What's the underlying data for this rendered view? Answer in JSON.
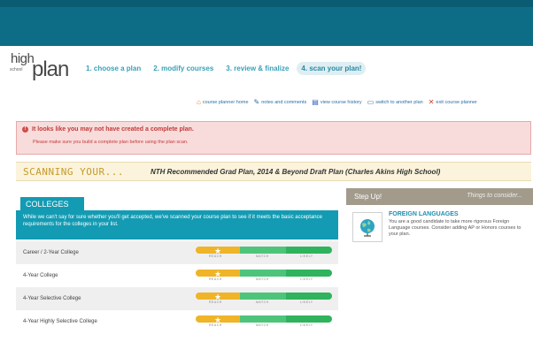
{
  "logo": {
    "high": "high",
    "school": "school",
    "plan": "plan"
  },
  "steps": [
    "1. choose a plan",
    "2. modify courses",
    "3. review & finalize",
    "4. scan your plan!"
  ],
  "tools": [
    {
      "icon": "home-icon",
      "glyph": "⌂",
      "label": "course planner home"
    },
    {
      "icon": "comments-icon",
      "glyph": "✎",
      "label": "notes and comments"
    },
    {
      "icon": "history-icon",
      "glyph": "▤",
      "label": "view course history"
    },
    {
      "icon": "switch-icon",
      "glyph": "▭",
      "label": "switch to another plan"
    },
    {
      "icon": "exit-icon",
      "glyph": "✕",
      "label": "exit course planner"
    }
  ],
  "alert": {
    "title": "It looks like you may not have created a complete plan.",
    "message": "Please make sure you build a complete plan before using the plan scan."
  },
  "scan": {
    "label": "SCANNING YOUR...",
    "plan": "NTH Recommended Grad Plan, 2014 & Beyond Draft Plan (Charles Akins High School)"
  },
  "colleges": {
    "tab": "COLLEGES",
    "intro": "While we can't say for sure whether you'll get accepted, we've scanned your course plan to see if it meets the basic acceptance requirements for the colleges in your list.",
    "meter_labels": [
      "REACH",
      "MATCH",
      "LIKELY"
    ],
    "rows": [
      {
        "name": "Career / 2-Year College"
      },
      {
        "name": "4-Year College"
      },
      {
        "name": "4-Year Selective College"
      },
      {
        "name": "4-Year Highly Selective College"
      }
    ]
  },
  "stepup": {
    "title": "Step Up!",
    "subtitle": "Things to consider...",
    "item_title": "FOREIGN LANGUAGES",
    "item_text": "You are a good candidate to take more rigorous Foreign Language courses. Consider adding AP or Honors courses to your plan."
  },
  "colors": {
    "topbar": "#0e6d86",
    "accent": "#139bb3",
    "reach": "#f0b429",
    "match": "#4ec47b",
    "likely": "#2fb35c"
  }
}
